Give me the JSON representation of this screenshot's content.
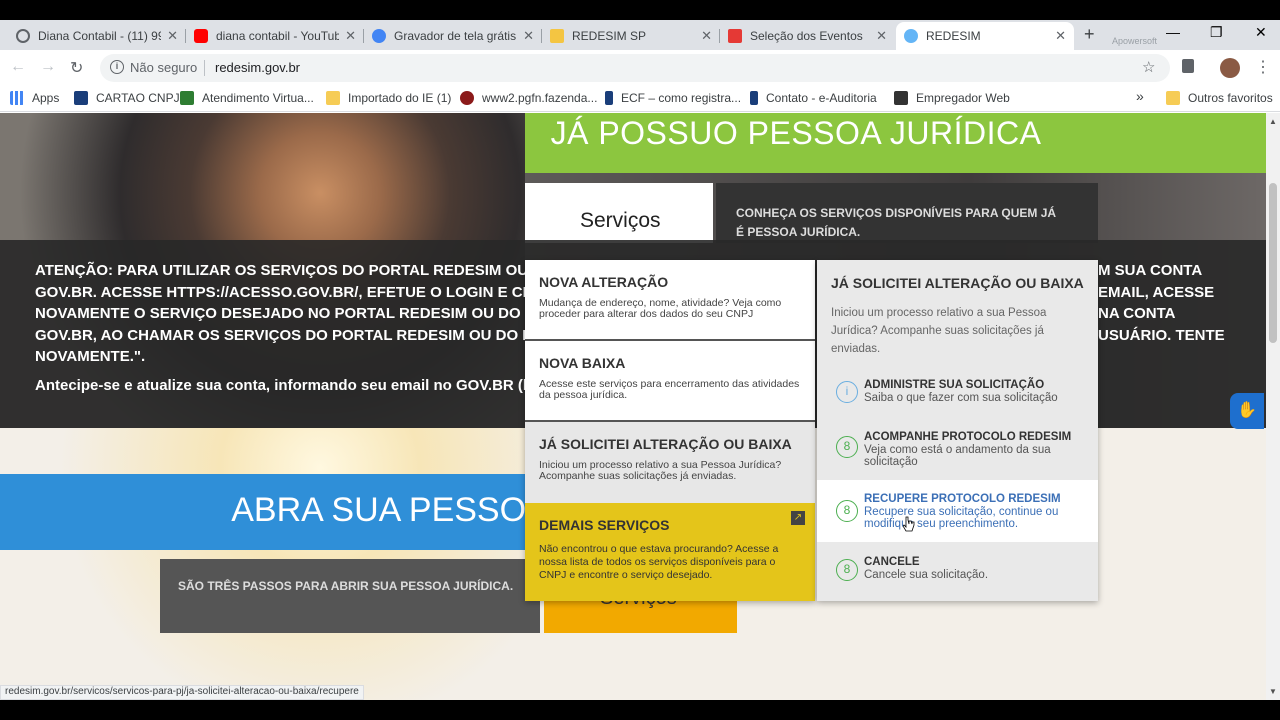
{
  "browser": {
    "tabs": [
      {
        "title": "Diana Contabil - (11) 99",
        "favicon_color": "#5f6368"
      },
      {
        "title": "diana contabil - YouTube",
        "favicon_color": "#ff0000"
      },
      {
        "title": "Gravador de tela grátis",
        "favicon_color": "#4285f4"
      },
      {
        "title": "REDESIM SP",
        "favicon_color": "#f4c542"
      },
      {
        "title": "Seleção dos Eventos",
        "favicon_color": "#e53935"
      },
      {
        "title": "REDESIM",
        "favicon_color": "#64b5f6"
      }
    ],
    "close_glyph": "✕",
    "new_tab_glyph": "+",
    "window_buttons": [
      "—",
      "❐",
      "✕"
    ],
    "watermark": "Apowersoft",
    "security_label": "Não seguro",
    "url": "redesim.gov.br",
    "bookmarks": [
      {
        "label": "Apps",
        "icon": "apps-grid-icon",
        "color": "#4285f4"
      },
      {
        "label": "CARTAO CNPJ",
        "icon": "gov-icon",
        "color": "#1a3e7a"
      },
      {
        "label": "Atendimento Virtua...",
        "icon": "flag-icon",
        "color": "#2e7d32"
      },
      {
        "label": "Importado do IE (1)",
        "icon": "folder-icon",
        "color": "#f6cc55"
      },
      {
        "label": "www2.pgfn.fazenda...",
        "icon": "globe-icon",
        "color": "#8b1a1a"
      },
      {
        "label": "ECF – como registra...",
        "icon": "e-icon",
        "color": "#1a3e7a"
      },
      {
        "label": "Contato - e-Auditoria",
        "icon": "e-icon",
        "color": "#1a3e7a"
      },
      {
        "label": "Empregador Web",
        "icon": "badge-icon",
        "color": "#333333"
      }
    ],
    "bookmarks_more": "»",
    "other_favorites": "Outros favoritos",
    "status_url": "redesim.gov.br/servicos/servicos-para-pj/ja-solicitei-alteracao-ou-baixa/recupere"
  },
  "page": {
    "green_title": "JÁ POSSUO PESSOA JURÍDICA",
    "servicos_tab": "Serviços",
    "conheca": "CONHEÇA OS SERVIÇOS DISPONÍVEIS PARA QUEM JÁ É PESSOA JURÍDICA.",
    "attention_lines": [
      "ATENÇÃO: PARA UTILIZAR OS SERVIÇOS DO PORTAL REDESIM OU DO PO",
      "GOV.BR. ACESSE HTTPS://ACESSO.GOV.BR/, EFETUE O LOGIN E CLIQUE N",
      "NOVAMENTE O SERVIÇO DESEJADO NO PORTAL REDESIM OU DO PORTAL",
      "GOV.BR, AO CHAMAR OS SERVIÇOS DO PORTAL REDESIM OU DO PORTAL",
      "NOVAMENTE.\"."
    ],
    "attention_right_lines": [
      "M SUA CONTA",
      " EMAIL, ACESSE",
      "NA CONTA",
      "USUÁRIO. TENTE"
    ],
    "antecipe": "Antecipe-se e atualize sua conta, informando seu email no GOV.BR (https:",
    "blue_title": "ABRA SUA PESSOA",
    "grey_box": "SÃO TRÊS PASSOS PARA ABRIR SUA PESSOA JURÍDICA.",
    "orange_button": "Serviços",
    "accessibility_icon": "hand-sign-icon"
  },
  "menu": {
    "left_items": [
      {
        "title": "NOVA ALTERAÇÃO",
        "desc": "Mudança de endereço, nome, atividade? Veja como proceder para alterar dos dados do seu CNPJ"
      },
      {
        "title": "NOVA BAIXA",
        "desc": "Acesse este serviços para encerramento das atividades da pessoa jurídica."
      },
      {
        "title": "JÁ SOLICITEI ALTERAÇÃO OU BAIXA",
        "desc": "Iniciou um processo relativo a sua Pessoa Jurídica? Acompanhe suas solicitações já enviadas."
      }
    ],
    "demais": {
      "title": "DEMAIS SERVIÇOS",
      "desc": "Não encontrou o que estava procurando? Acesse a nossa lista de todos os serviços disponíveis para o CNPJ e encontre o serviço desejado.",
      "ext_icon": "↗"
    },
    "right_title": "JÁ SOLICITEI ALTERAÇÃO OU BAIXA",
    "right_desc": "Iniciou um processo relativo a sua Pessoa Jurídica? Acompanhe suas solicitações já enviadas.",
    "sub_items": [
      {
        "title": "ADMINISTRE SUA SOLICITAÇÃO",
        "desc": "Saiba o que fazer com sua solicitação",
        "icon": "info-icon",
        "glyph": "i"
      },
      {
        "title": "ACOMPANHE PROTOCOLO REDESIM",
        "desc": "Veja como está o andamento da sua solicitação",
        "icon": "person-circle-icon",
        "glyph": "8"
      },
      {
        "title": "RECUPERE PROTOCOLO REDESIM",
        "desc": "Recupere sua solicitação, continue ou modifique seu preenchimento.",
        "icon": "person-circle-icon",
        "glyph": "8"
      },
      {
        "title": "CANCELE",
        "desc": "Cancele sua solicitação.",
        "icon": "person-circle-icon",
        "glyph": "8"
      }
    ]
  },
  "colors": {
    "green": "#8cc63f",
    "blue": "#2f8fd8",
    "yellow": "#e4c51a",
    "orange": "#f2a900",
    "link": "#3b6fb6"
  }
}
